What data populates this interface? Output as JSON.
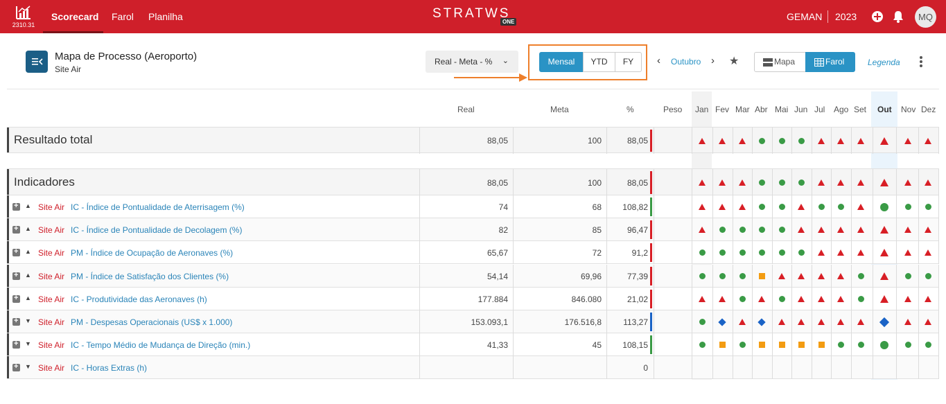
{
  "topbar": {
    "version": "2310.31",
    "nav": [
      "Scorecard",
      "Farol",
      "Planilha"
    ],
    "brand": "STRATWS",
    "brand_badge": "ONE",
    "company": "GEMAN",
    "year": "2023",
    "avatar": "MQ",
    "icons": [
      "chart-logo-icon",
      "plus-circle-icon",
      "bell-icon"
    ]
  },
  "header": {
    "title": "Mapa de Processo (Aeroporto)",
    "subtitle": "Site Air",
    "view_select": "Real - Meta - %",
    "periods": [
      "Mensal",
      "YTD",
      "FY"
    ],
    "active_period": "Mensal",
    "month": "Outubro",
    "views": [
      "Mapa",
      "Farol"
    ],
    "active_view": "Farol",
    "legend": "Legenda"
  },
  "columns": {
    "real": "Real",
    "meta": "Meta",
    "pct": "%",
    "peso": "Peso",
    "months": [
      "Jan",
      "Fev",
      "Mar",
      "Abr",
      "Mai",
      "Jun",
      "Jul",
      "Ago",
      "Set",
      "Out",
      "Nov",
      "Dez"
    ]
  },
  "colors": {
    "red": "#d81f26",
    "green": "#3a9b46",
    "orange": "#f39c12",
    "blue": "#1a63c6",
    "accent": "#2a93c5",
    "brand": "#cf1f2a"
  },
  "summary": [
    {
      "label": "Resultado total",
      "real": "88,05",
      "meta": "100",
      "pct": "88,05",
      "bar": "red",
      "months": [
        "t",
        "t",
        "t",
        "d",
        "d",
        "d",
        "t",
        "t",
        "t",
        "t",
        "t",
        "t"
      ]
    },
    {
      "label": "Indicadores",
      "real": "88,05",
      "meta": "100",
      "pct": "88,05",
      "bar": "red",
      "months": [
        "t",
        "t",
        "t",
        "d",
        "d",
        "d",
        "t",
        "t",
        "t",
        "t",
        "t",
        "t"
      ]
    }
  ],
  "indicators": [
    {
      "trend": "up",
      "src": "Site Air",
      "name": "IC - Índice de Pontualidade de Aterrisagem (%)",
      "real": "74",
      "meta": "68",
      "pct": "108,82",
      "bar": "green",
      "months": [
        "t",
        "t",
        "t",
        "d",
        "d",
        "t",
        "d",
        "d",
        "t",
        "d",
        "d",
        "d"
      ]
    },
    {
      "trend": "up",
      "src": "Site Air",
      "name": "IC - Índice de Pontualidade de Decolagem (%)",
      "real": "82",
      "meta": "85",
      "pct": "96,47",
      "bar": "red",
      "months": [
        "t",
        "d",
        "d",
        "d",
        "d",
        "t",
        "t",
        "t",
        "t",
        "t",
        "t",
        "t"
      ]
    },
    {
      "trend": "up",
      "src": "Site Air",
      "name": "PM - Índice de Ocupação de Aeronaves (%)",
      "real": "65,67",
      "meta": "72",
      "pct": "91,2",
      "bar": "red",
      "months": [
        "d",
        "d",
        "d",
        "d",
        "d",
        "d",
        "t",
        "t",
        "t",
        "t",
        "t",
        "t"
      ]
    },
    {
      "trend": "up",
      "src": "Site Air",
      "name": "PM - Índice de Satisfação dos Clientes (%)",
      "real": "54,14",
      "meta": "69,96",
      "pct": "77,39",
      "bar": "red",
      "months": [
        "d",
        "d",
        "d",
        "s",
        "t",
        "t",
        "t",
        "t",
        "d",
        "t",
        "d",
        "d"
      ]
    },
    {
      "trend": "up",
      "src": "Site Air",
      "name": "IC - Produtividade das Aeronaves (h)",
      "real": "177.884",
      "meta": "846.080",
      "pct": "21,02",
      "bar": "red",
      "months": [
        "t",
        "t",
        "d",
        "t",
        "d",
        "t",
        "t",
        "t",
        "d",
        "t",
        "t",
        "t"
      ]
    },
    {
      "trend": "down",
      "src": "Site Air",
      "name": "PM - Despesas Operacionais (US$ x 1.000)",
      "real": "153.093,1",
      "meta": "176.516,8",
      "pct": "113,27",
      "bar": "blue",
      "months": [
        "d",
        "b",
        "t",
        "b",
        "t",
        "t",
        "t",
        "t",
        "t",
        "b",
        "t",
        "t"
      ]
    },
    {
      "trend": "down",
      "src": "Site Air",
      "name": "IC - Tempo Médio de Mudança de Direção (min.)",
      "real": "41,33",
      "meta": "45",
      "pct": "108,15",
      "bar": "green",
      "months": [
        "d",
        "s",
        "d",
        "s",
        "s",
        "s",
        "s",
        "d",
        "d",
        "d",
        "d",
        "d"
      ]
    },
    {
      "trend": "down",
      "src": "Site Air",
      "name": "IC - Horas Extras (h)",
      "real": "",
      "meta": "",
      "pct": "0",
      "bar": "",
      "months": [
        "",
        "",
        "",
        "",
        "",
        "",
        "",
        "",
        "",
        "",
        "",
        ""
      ]
    }
  ]
}
